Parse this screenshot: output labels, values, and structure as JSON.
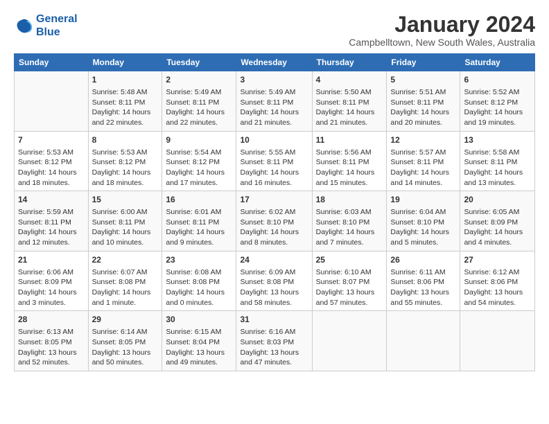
{
  "logo": {
    "line1": "General",
    "line2": "Blue"
  },
  "title": "January 2024",
  "subtitle": "Campbelltown, New South Wales, Australia",
  "days_header": [
    "Sunday",
    "Monday",
    "Tuesday",
    "Wednesday",
    "Thursday",
    "Friday",
    "Saturday"
  ],
  "weeks": [
    [
      {
        "num": "",
        "info": ""
      },
      {
        "num": "1",
        "info": "Sunrise: 5:48 AM\nSunset: 8:11 PM\nDaylight: 14 hours\nand 22 minutes."
      },
      {
        "num": "2",
        "info": "Sunrise: 5:49 AM\nSunset: 8:11 PM\nDaylight: 14 hours\nand 22 minutes."
      },
      {
        "num": "3",
        "info": "Sunrise: 5:49 AM\nSunset: 8:11 PM\nDaylight: 14 hours\nand 21 minutes."
      },
      {
        "num": "4",
        "info": "Sunrise: 5:50 AM\nSunset: 8:11 PM\nDaylight: 14 hours\nand 21 minutes."
      },
      {
        "num": "5",
        "info": "Sunrise: 5:51 AM\nSunset: 8:11 PM\nDaylight: 14 hours\nand 20 minutes."
      },
      {
        "num": "6",
        "info": "Sunrise: 5:52 AM\nSunset: 8:12 PM\nDaylight: 14 hours\nand 19 minutes."
      }
    ],
    [
      {
        "num": "7",
        "info": "Sunrise: 5:53 AM\nSunset: 8:12 PM\nDaylight: 14 hours\nand 18 minutes."
      },
      {
        "num": "8",
        "info": "Sunrise: 5:53 AM\nSunset: 8:12 PM\nDaylight: 14 hours\nand 18 minutes."
      },
      {
        "num": "9",
        "info": "Sunrise: 5:54 AM\nSunset: 8:12 PM\nDaylight: 14 hours\nand 17 minutes."
      },
      {
        "num": "10",
        "info": "Sunrise: 5:55 AM\nSunset: 8:11 PM\nDaylight: 14 hours\nand 16 minutes."
      },
      {
        "num": "11",
        "info": "Sunrise: 5:56 AM\nSunset: 8:11 PM\nDaylight: 14 hours\nand 15 minutes."
      },
      {
        "num": "12",
        "info": "Sunrise: 5:57 AM\nSunset: 8:11 PM\nDaylight: 14 hours\nand 14 minutes."
      },
      {
        "num": "13",
        "info": "Sunrise: 5:58 AM\nSunset: 8:11 PM\nDaylight: 14 hours\nand 13 minutes."
      }
    ],
    [
      {
        "num": "14",
        "info": "Sunrise: 5:59 AM\nSunset: 8:11 PM\nDaylight: 14 hours\nand 12 minutes."
      },
      {
        "num": "15",
        "info": "Sunrise: 6:00 AM\nSunset: 8:11 PM\nDaylight: 14 hours\nand 10 minutes."
      },
      {
        "num": "16",
        "info": "Sunrise: 6:01 AM\nSunset: 8:11 PM\nDaylight: 14 hours\nand 9 minutes."
      },
      {
        "num": "17",
        "info": "Sunrise: 6:02 AM\nSunset: 8:10 PM\nDaylight: 14 hours\nand 8 minutes."
      },
      {
        "num": "18",
        "info": "Sunrise: 6:03 AM\nSunset: 8:10 PM\nDaylight: 14 hours\nand 7 minutes."
      },
      {
        "num": "19",
        "info": "Sunrise: 6:04 AM\nSunset: 8:10 PM\nDaylight: 14 hours\nand 5 minutes."
      },
      {
        "num": "20",
        "info": "Sunrise: 6:05 AM\nSunset: 8:09 PM\nDaylight: 14 hours\nand 4 minutes."
      }
    ],
    [
      {
        "num": "21",
        "info": "Sunrise: 6:06 AM\nSunset: 8:09 PM\nDaylight: 14 hours\nand 3 minutes."
      },
      {
        "num": "22",
        "info": "Sunrise: 6:07 AM\nSunset: 8:08 PM\nDaylight: 14 hours\nand 1 minute."
      },
      {
        "num": "23",
        "info": "Sunrise: 6:08 AM\nSunset: 8:08 PM\nDaylight: 14 hours\nand 0 minutes."
      },
      {
        "num": "24",
        "info": "Sunrise: 6:09 AM\nSunset: 8:08 PM\nDaylight: 13 hours\nand 58 minutes."
      },
      {
        "num": "25",
        "info": "Sunrise: 6:10 AM\nSunset: 8:07 PM\nDaylight: 13 hours\nand 57 minutes."
      },
      {
        "num": "26",
        "info": "Sunrise: 6:11 AM\nSunset: 8:06 PM\nDaylight: 13 hours\nand 55 minutes."
      },
      {
        "num": "27",
        "info": "Sunrise: 6:12 AM\nSunset: 8:06 PM\nDaylight: 13 hours\nand 54 minutes."
      }
    ],
    [
      {
        "num": "28",
        "info": "Sunrise: 6:13 AM\nSunset: 8:05 PM\nDaylight: 13 hours\nand 52 minutes."
      },
      {
        "num": "29",
        "info": "Sunrise: 6:14 AM\nSunset: 8:05 PM\nDaylight: 13 hours\nand 50 minutes."
      },
      {
        "num": "30",
        "info": "Sunrise: 6:15 AM\nSunset: 8:04 PM\nDaylight: 13 hours\nand 49 minutes."
      },
      {
        "num": "31",
        "info": "Sunrise: 6:16 AM\nSunset: 8:03 PM\nDaylight: 13 hours\nand 47 minutes."
      },
      {
        "num": "",
        "info": ""
      },
      {
        "num": "",
        "info": ""
      },
      {
        "num": "",
        "info": ""
      }
    ]
  ]
}
